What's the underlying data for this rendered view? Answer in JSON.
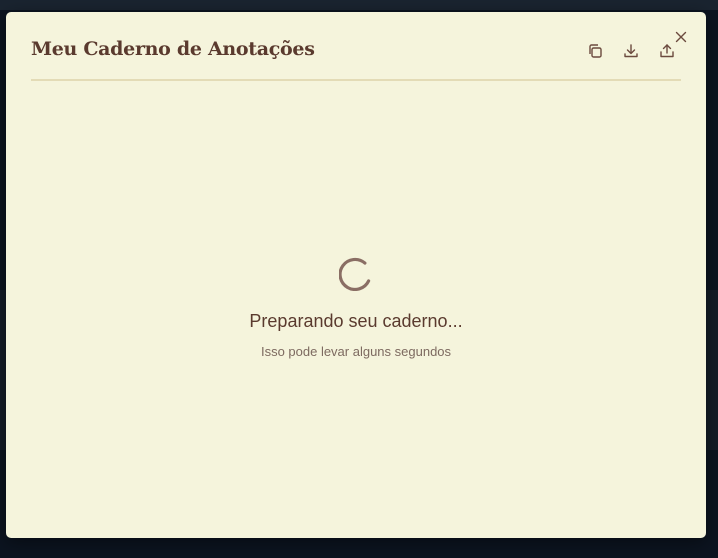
{
  "modal": {
    "title": "Meu Caderno de Anotações",
    "actions": {
      "copy_icon": "copy-icon",
      "download_icon": "download-icon",
      "share_icon": "share-icon",
      "close_icon": "close-icon"
    }
  },
  "loading": {
    "title": "Preparando seu caderno...",
    "subtitle": "Isso pode levar alguns segundos"
  },
  "colors": {
    "modal_bg": "#f5f4dc",
    "title": "#5a3a2e",
    "subtitle": "#7d6a60",
    "icon": "#6b4a3e",
    "spinner": "#8a6e64",
    "divider": "#e3dbb6",
    "backdrop": "#0c1420"
  }
}
